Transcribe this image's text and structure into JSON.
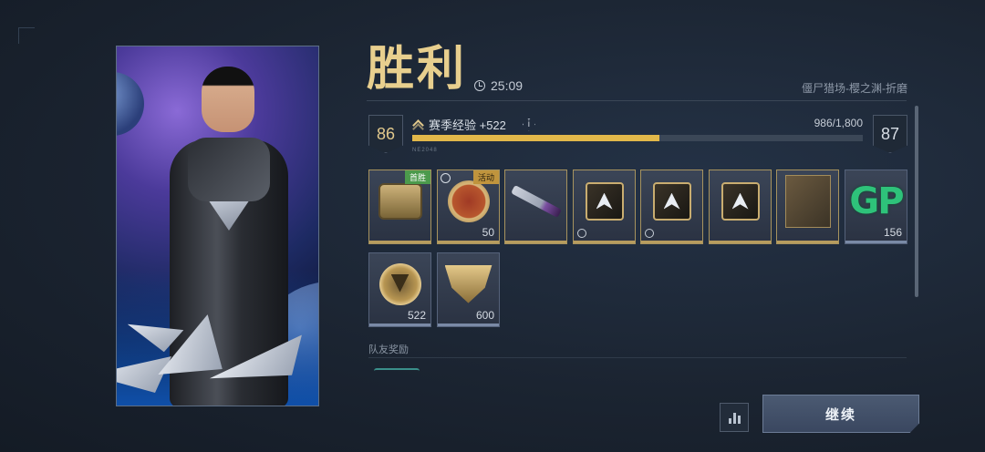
{
  "header": {
    "title": "胜利",
    "timer": "25:09",
    "mode": "僵尸猎场-樱之渊-折磨"
  },
  "progress": {
    "current_level": "86",
    "next_level": "87",
    "xp_label": "赛季经验 +522",
    "xp_count": "986/1,800",
    "xp_fraction": 0.548,
    "code": "NE2048"
  },
  "rewards": [
    {
      "icon": "loot-box-icon",
      "badge": "首胜",
      "badge_color": "green",
      "count": ""
    },
    {
      "icon": "pig-coin-icon",
      "badge": "活动",
      "badge_color": "gold",
      "count": "50",
      "timed": true
    },
    {
      "icon": "sword-icon",
      "badge": "",
      "count": ""
    },
    {
      "icon": "emblem-card-icon",
      "badge": "",
      "count": ""
    },
    {
      "icon": "arrow-card-icon",
      "badge": "",
      "count": ""
    },
    {
      "icon": "flame-card-icon",
      "badge": "",
      "count": ""
    },
    {
      "icon": "weapon-case-icon",
      "badge": "",
      "count": ""
    },
    {
      "icon": "gp-icon",
      "label": "GP",
      "badge": "",
      "count": "156"
    },
    {
      "icon": "coin-icon",
      "badge": "",
      "count": "522"
    },
    {
      "icon": "emblem-icon",
      "badge": "",
      "count": "600"
    }
  ],
  "team": {
    "label": "队友奖励"
  },
  "actions": {
    "continue_label": "继续"
  }
}
